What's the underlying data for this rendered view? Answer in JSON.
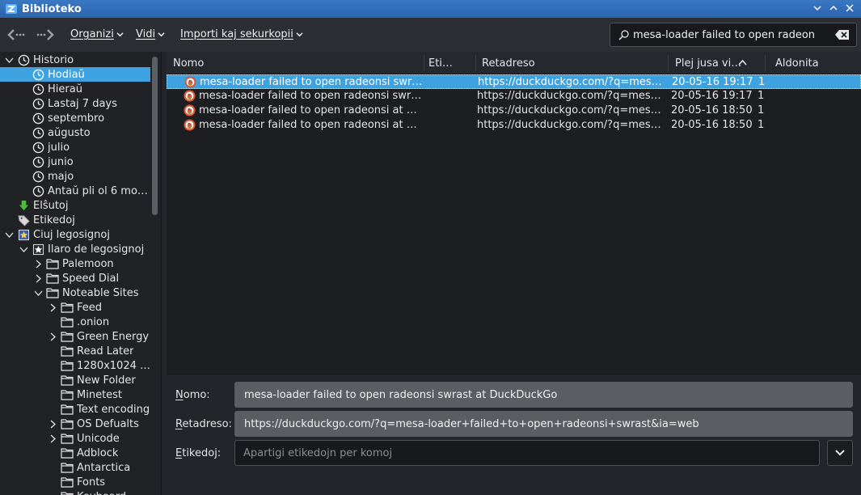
{
  "window": {
    "title": "Biblioteko"
  },
  "toolbar": {
    "menus": [
      {
        "label": "Organizi"
      },
      {
        "label": "Vidi"
      },
      {
        "label": "Importi kaj sekurkopii"
      }
    ],
    "search": {
      "value": "mesa-loader failed to open radeon"
    }
  },
  "sidebar": {
    "items": [
      {
        "label": "Historio",
        "icon": "clock-icon"
      },
      {
        "label": "Hodiaŭ",
        "icon": "clock-icon",
        "selected": true
      },
      {
        "label": "Hieraŭ",
        "icon": "clock-icon"
      },
      {
        "label": "Lastaj 7 days",
        "icon": "clock-icon"
      },
      {
        "label": "septembro",
        "icon": "clock-icon"
      },
      {
        "label": "aŭgusto",
        "icon": "clock-icon"
      },
      {
        "label": "julio",
        "icon": "clock-icon"
      },
      {
        "label": "junio",
        "icon": "clock-icon"
      },
      {
        "label": "majo",
        "icon": "clock-icon"
      },
      {
        "label": "Antaŭ pli ol 6 mon…",
        "icon": "clock-icon"
      },
      {
        "label": "Elŝutoj",
        "icon": "download-icon"
      },
      {
        "label": "Etikedoj",
        "icon": "tag-icon"
      },
      {
        "label": "Ĉiuj legosignoj",
        "icon": "bookmarks-icon"
      },
      {
        "label": "Ilaro de legosignoj",
        "icon": "star-folder-icon"
      },
      {
        "label": "Palemoon",
        "icon": "folder-icon"
      },
      {
        "label": "Speed Dial",
        "icon": "folder-icon"
      },
      {
        "label": "Noteable Sites",
        "icon": "folder-icon"
      },
      {
        "label": "Feed",
        "icon": "folder-icon"
      },
      {
        "label": ".onion",
        "icon": "folder-icon"
      },
      {
        "label": "Green Energy",
        "icon": "folder-icon"
      },
      {
        "label": "Read Later",
        "icon": "folder-icon"
      },
      {
        "label": "1280x1024 T…",
        "icon": "folder-icon"
      },
      {
        "label": "New Folder",
        "icon": "folder-icon"
      },
      {
        "label": "Minetest",
        "icon": "folder-icon"
      },
      {
        "label": "Text encoding",
        "icon": "folder-icon"
      },
      {
        "label": "OS Defualts",
        "icon": "folder-icon"
      },
      {
        "label": "Unicode",
        "icon": "folder-icon"
      },
      {
        "label": "Adblock",
        "icon": "folder-icon"
      },
      {
        "label": "Antarctica",
        "icon": "folder-icon"
      },
      {
        "label": "Fonts",
        "icon": "folder-icon"
      },
      {
        "label": "Keyboard…",
        "icon": "folder-icon"
      }
    ]
  },
  "list": {
    "columns": [
      {
        "label": "Nomo"
      },
      {
        "label": "Eti…"
      },
      {
        "label": "Retadreso"
      },
      {
        "label": "Plej jusa vi…"
      },
      {
        "label": "Aldonita"
      }
    ],
    "rows": [
      {
        "name": "mesa-loader failed to open radeonsi swrast a…",
        "url": "https://duckduckgo.com/?q=mesa-loa…",
        "visited": "20-05-16 19:17",
        "count": "1",
        "selected": true
      },
      {
        "name": "mesa-loader failed to open radeonsi swrast a…",
        "url": "https://duckduckgo.com/?q=mesa-loa…",
        "visited": "20-05-16 19:17",
        "count": "1"
      },
      {
        "name": "mesa-loader failed to open radeonsi at Duck…",
        "url": "https://duckduckgo.com/?q=mesa-loa…",
        "visited": "20-05-16 18:50",
        "count": "1"
      },
      {
        "name": "mesa-loader failed to open radeonsi at Duck…",
        "url": "https://duckduckgo.com/?q=mesa-loa…",
        "visited": "20-05-16 18:50",
        "count": "1"
      }
    ]
  },
  "details": {
    "name_label_key": "N",
    "name_label_rest": "omo:",
    "name_value": "mesa-loader failed to open radeonsi swrast at DuckDuckGo",
    "url_label_key": "R",
    "url_label_rest": "etadreso:",
    "url_value": "https://duckduckgo.com/?q=mesa-loader+failed+to+open+radeonsi+swrast&ia=web",
    "tags_label_key": "E",
    "tags_label_rest": "tikedoj:",
    "tags_placeholder": "Apartigi etikedojn per komoj"
  },
  "colors": {
    "accent": "#3ea2e0",
    "titlebar": "#2f6db8"
  }
}
